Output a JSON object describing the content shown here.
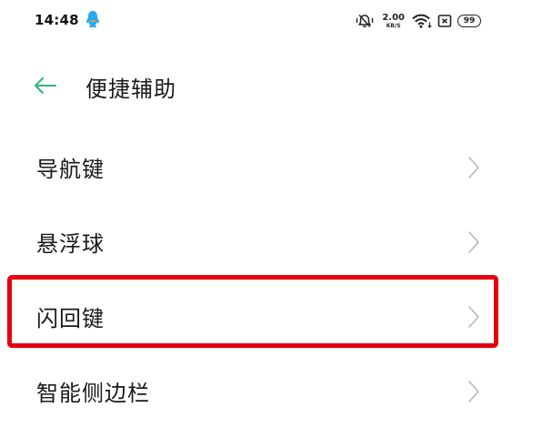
{
  "status_bar": {
    "time": "14:48",
    "net_speed_value": "2.00",
    "net_speed_unit": "KB/S",
    "battery_level": "99",
    "icons": [
      "qq-icon",
      "mute-icon",
      "wifi-icon",
      "sim-icon",
      "battery-icon"
    ]
  },
  "header": {
    "back_icon": "back-arrow-icon",
    "title": "便捷辅助"
  },
  "menu": {
    "items": [
      {
        "label": "导航键"
      },
      {
        "label": "悬浮球"
      },
      {
        "label": "闪回键"
      },
      {
        "label": "智能侧边栏"
      }
    ]
  },
  "colors": {
    "accent_green": "#2fb37a",
    "highlight_red": "#e5000f",
    "qq_blue": "#27a9f0"
  }
}
